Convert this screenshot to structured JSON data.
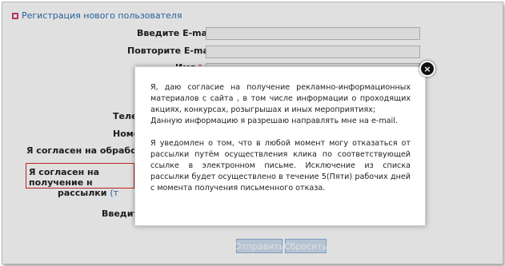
{
  "form": {
    "title": "Регистрация нового пользователя",
    "labels": {
      "email": "Введите E-mail",
      "email_repeat": "Повторите E-mail",
      "name": "Имя",
      "phone": "Телеф",
      "number": "Номер",
      "consent_processing": "Я согласен на обработку мо",
      "consent_marketing_l1": "Я согласен на получение н",
      "consent_marketing_l2": "рассылки",
      "consent_marketing_link": "(т",
      "enter": "Введите"
    },
    "required_mark": "*",
    "buttons": {
      "submit": "Отправить",
      "reset": "Сбросить"
    }
  },
  "modal": {
    "close_glyph": "×",
    "paragraph1_line1": "Я, даю согласие на получение рекламно-информационных материалов с сайта , в том числе информации о проходящих акциях, конкурсах, розыгрышах и иных мероприятиях;",
    "paragraph1_line2": "Данную информацию я разрешаю направлять мне на e-mail.",
    "paragraph2": "Я уведомлен о том, что в любой момент могу отказаться от рассылки путём осуществления клика по соответствующей ссылке в электронном письме. Исключение из списка рассылки будет осуществлено в течение 5(Пяти) рабочих дней с момента получения письменного отказа."
  },
  "colors": {
    "link_blue": "#2b6fb3",
    "accent_pink": "#d23c7a",
    "highlight_red": "#d82828"
  }
}
